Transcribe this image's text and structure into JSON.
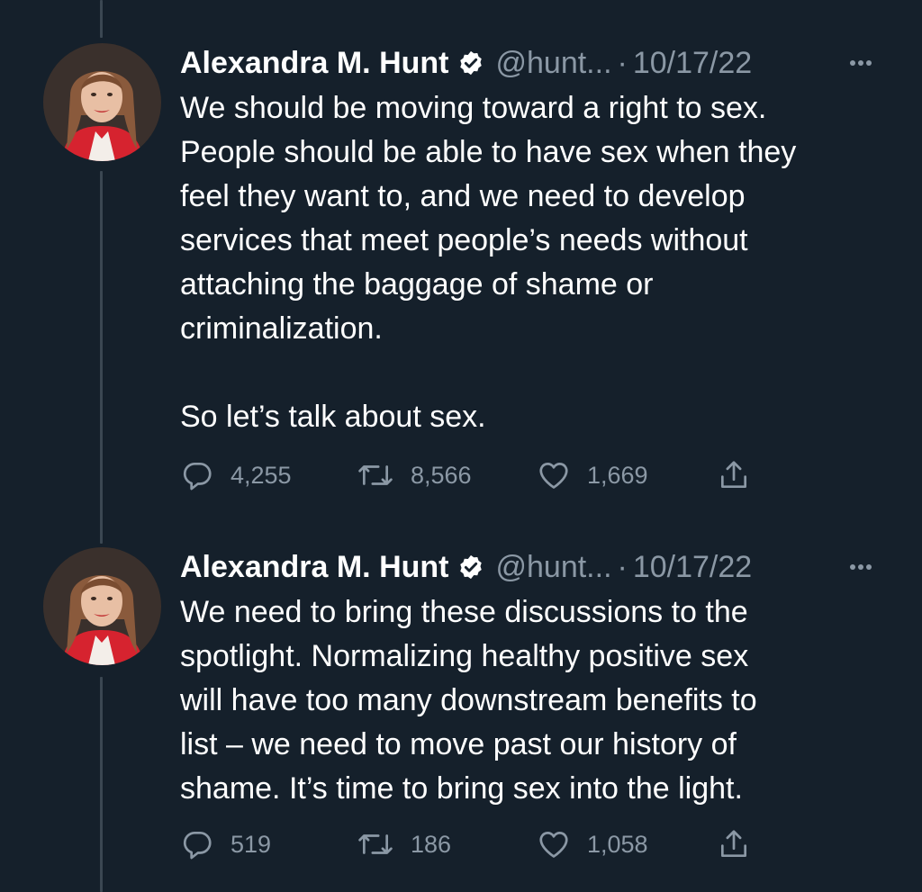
{
  "tweets": [
    {
      "author": {
        "name": "Alexandra M. Hunt",
        "handle": "@hunt...",
        "verified": true,
        "avatar": "avatar-photo"
      },
      "separator": "·",
      "date": "10/17/22",
      "text": "We should be moving toward a right to sex.\nPeople should be able to have sex when they\nfeel they want to, and we need to develop\nservices that meet people’s needs without\nattaching the baggage of shame or\ncriminalization.\n\nSo let’s talk about sex.",
      "stats": {
        "replies": "4,255",
        "retweets": "8,566",
        "likes": "1,669"
      }
    },
    {
      "author": {
        "name": "Alexandra M. Hunt",
        "handle": "@hunt...",
        "verified": true,
        "avatar": "avatar-photo"
      },
      "separator": "·",
      "date": "10/17/22",
      "text": "We need to bring these discussions to the\nspotlight. Normalizing healthy positive sex\nwill have too many downstream benefits to\nlist – we need to move past our history of\nshame. It’s time to bring sex into the light.",
      "stats": {
        "replies": "519",
        "retweets": "186",
        "likes": "1,058"
      }
    }
  ],
  "icons": {
    "reply": "reply-icon",
    "retweet": "retweet-icon",
    "like": "heart-icon",
    "share": "share-icon",
    "more": "more-options-icon",
    "verified": "verified-badge-icon"
  },
  "colors": {
    "background": "#15202b",
    "text": "#ffffff",
    "secondary": "#8b98a5",
    "thread_line": "#3b4752",
    "accent_red": "#d6232f",
    "verified_badge": "#ffffff"
  }
}
